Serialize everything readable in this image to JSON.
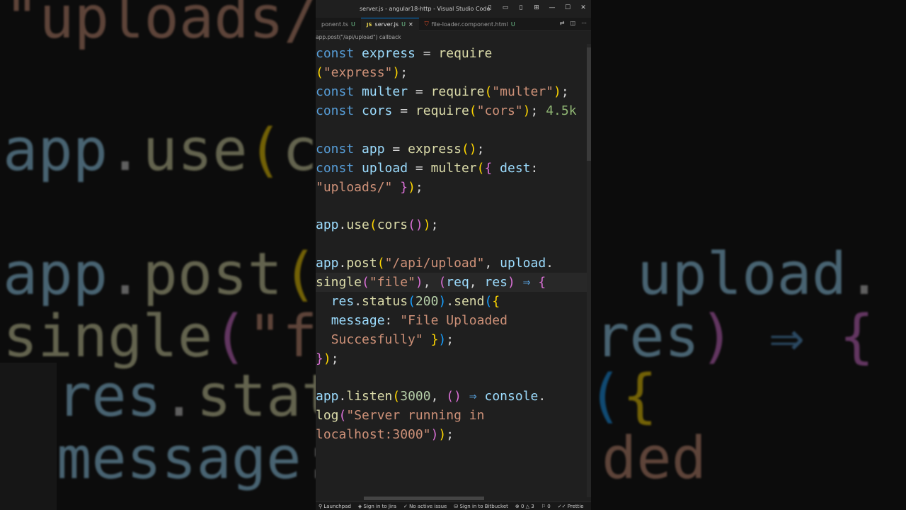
{
  "window": {
    "title": "server.js - angular18-http - Visual Studio Code"
  },
  "tabs": [
    {
      "label": "ponent.ts",
      "badge": "U"
    },
    {
      "label": "server.js",
      "badge": "U",
      "icon": "JS"
    },
    {
      "label": "file-loader.component.html",
      "badge": "U"
    }
  ],
  "breadcrumb": "app.post(\"/api/upload\") callback",
  "code": {
    "inlay_hint": "4.5k"
  },
  "status_bar": {
    "launchpad": "Launchpad",
    "jira": "Sign in to Jira",
    "issue": "No active issue",
    "bitbucket": "Sign in to Bitbucket",
    "errors": "0",
    "warnings": "3",
    "info": "0",
    "prettier": "Prettie"
  },
  "colors": {
    "keyword": "#569cd6",
    "string": "#ce9178",
    "function": "#dcdcaa",
    "variable": "#9cdcfe",
    "number": "#b5cea8",
    "accent": "#0078d4"
  }
}
